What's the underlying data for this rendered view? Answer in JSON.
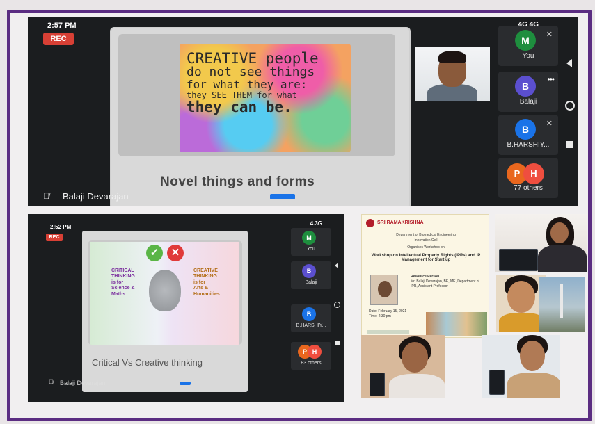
{
  "top_call": {
    "time": "2:57 PM",
    "signal": "4G 4G",
    "rec_label": "REC",
    "slide": {
      "quote_lines": [
        "CREATIVE people",
        "do not see things",
        "for what they are:",
        "they SEE THEM for what",
        "they can be."
      ],
      "title": "Novel things and forms"
    },
    "speaker_name": "Balaji Devarajan",
    "participants": [
      {
        "initial": "M",
        "name": "You",
        "color": "#1e8e3e",
        "muted": true
      },
      {
        "initial": "B",
        "name": "Balaji",
        "color": "#5b4fcf",
        "muted": false,
        "more": "•••"
      },
      {
        "initial": "B",
        "name": "B.HARSHIY...",
        "color": "#1a73e8",
        "muted": true
      },
      {
        "initial_a": "P",
        "initial_b": "H",
        "name": "77 others"
      }
    ]
  },
  "bottom_left_call": {
    "time": "2:52 PM",
    "signal": "4.3G",
    "rec_label": "REC",
    "slide": {
      "left_text": "CRITICAL\nTHINKING\nis for\nScience &\nMaths",
      "right_text": "CREATIVE\nTHINKING\nis for\nArts &\nHumanities",
      "title": "Critical Vs Creative thinking"
    },
    "speaker_name": "Balaji Devarajan",
    "participants": [
      {
        "initial": "M",
        "name": "You",
        "color": "#1e8e3e"
      },
      {
        "initial": "B",
        "name": "Balaji",
        "color": "#5b4fcf"
      },
      {
        "initial": "B",
        "name": "B.HARSHIY...",
        "color": "#1a73e8"
      },
      {
        "initial_a": "P",
        "initial_b": "H",
        "name": "83 others"
      }
    ]
  },
  "flyer": {
    "institution": "SRI RAMAKRISHNA",
    "dept": "Department of Biomedical Engineering",
    "cell": "Innovation Cell",
    "organises": "Organises Workshop on",
    "workshop_title": "Workshop on Intellectual Property Rights (IPRs) and IP Management for Start up",
    "resource_label": "Resource Person",
    "resource_details": "Mr. Balaji Devarajan, BE, ME, Department of IPR, Assistant Professor",
    "date": "Date: February 15, 2021",
    "time": "Time: 2:30 pm"
  }
}
